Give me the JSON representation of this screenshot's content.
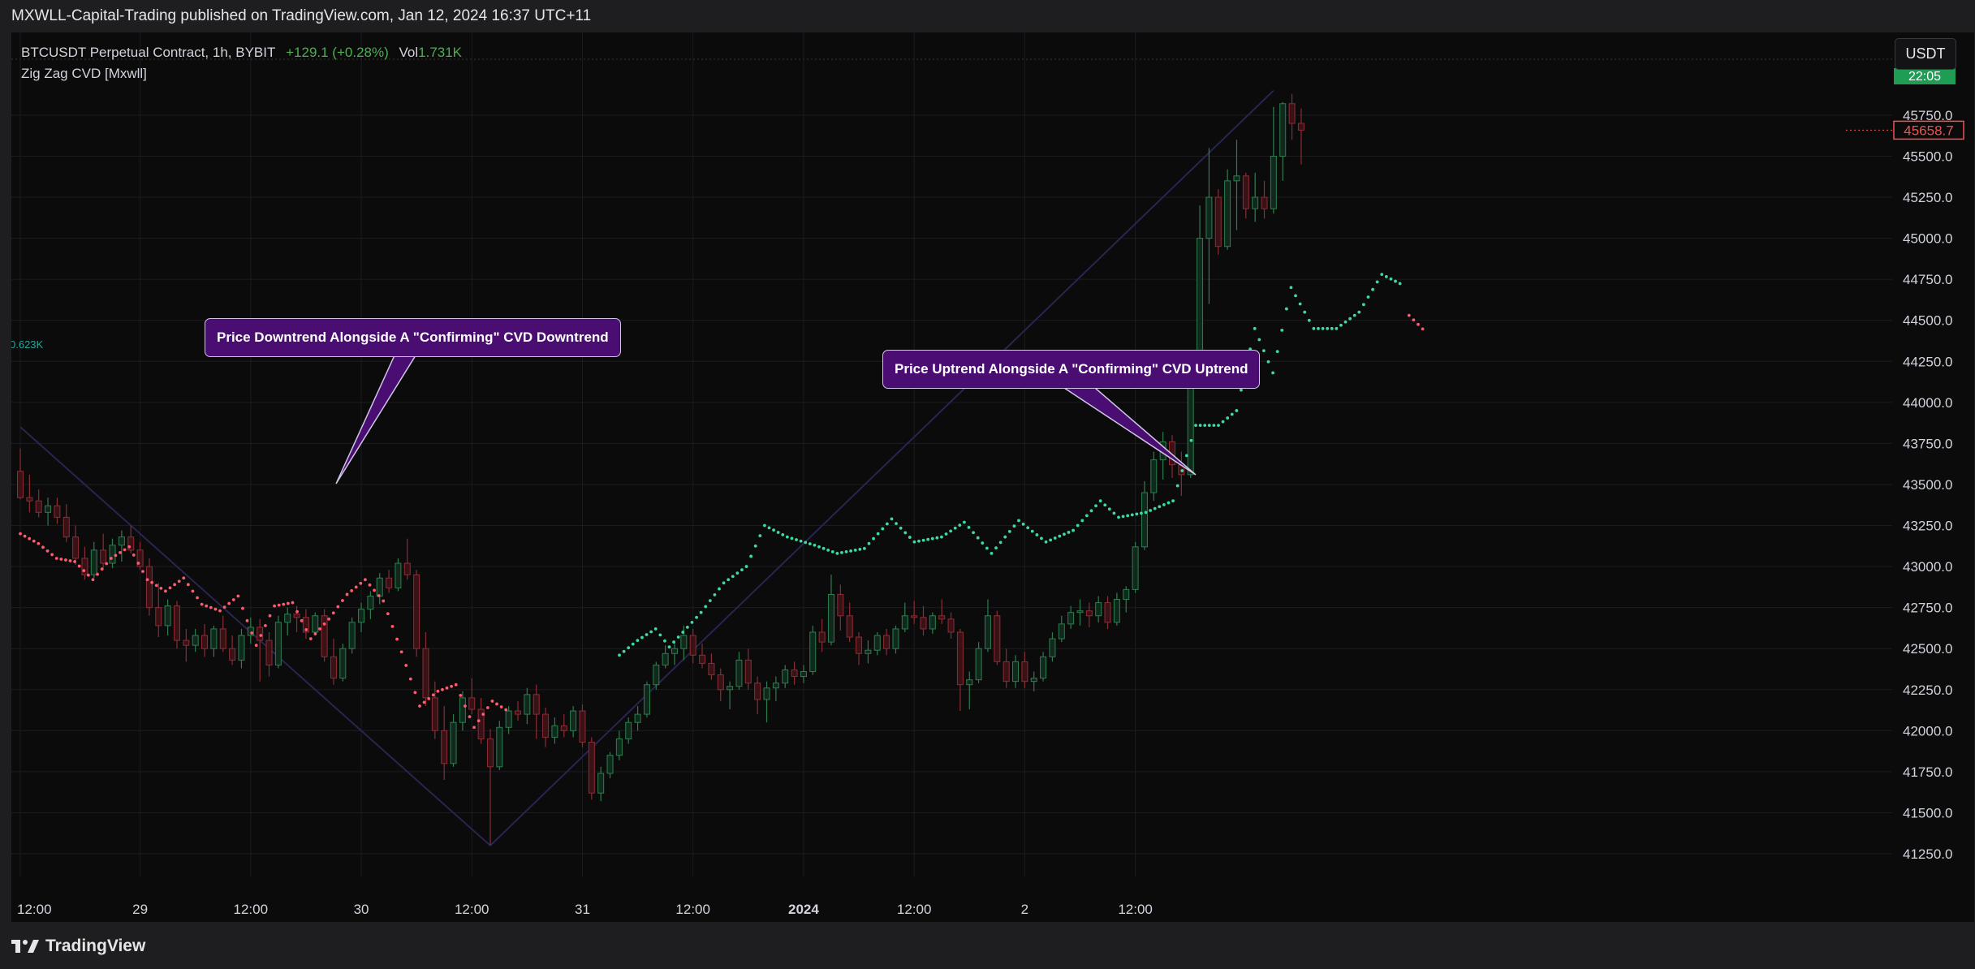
{
  "header": {
    "published": "MXWLL-Capital-Trading published on TradingView.com, Jan 12, 2024 16:37 UTC+11"
  },
  "legend": {
    "symbol": "BTCUSDT Perpetual Contract, 1h, BYBIT",
    "change": "+129.1 (+0.28%)",
    "vol_label": "Vol",
    "vol_value": "1.731K",
    "indicator": "Zig Zag CVD [Mxwll]",
    "left_value": "0.623K"
  },
  "currency_button": "USDT",
  "time_tag": "22:05",
  "price_tag": "45658.7",
  "annotations": [
    {
      "text": "Price Downtrend Alongside A \"Confirming\" CVD Downtrend"
    },
    {
      "text": "Price Uptrend Alongside A \"Confirming\" CVD Uptrend"
    }
  ],
  "footer": {
    "brand": "TradingView"
  },
  "colors": {
    "background": "#0b0b0c",
    "up": "#26a69a",
    "down": "#ef5350",
    "cvd_up": "#3fd9a2",
    "cvd_down": "#ff5a6e",
    "zigzag": "#2a2450",
    "callout": "#4a0e72"
  },
  "chart_data": {
    "type": "candlestick",
    "title": "",
    "xlabel": "",
    "ylabel": "",
    "x_ticks": [
      "12:00",
      "29",
      "12:00",
      "30",
      "12:00",
      "31",
      "12:00",
      "2024",
      "12:00",
      "2",
      "12:00"
    ],
    "x_tick_index": [
      0,
      13,
      25,
      37,
      49,
      61,
      73,
      85,
      97,
      109,
      121
    ],
    "y_ticks": [
      41250.0,
      41500.0,
      41750.0,
      42000.0,
      42250.0,
      42500.0,
      42750.0,
      43000.0,
      43250.0,
      43500.0,
      43750.0,
      44000.0,
      44250.0,
      44500.0,
      44750.0,
      45000.0,
      45250.0,
      45500.0,
      45750.0
    ],
    "ylim": [
      41100,
      45950
    ],
    "last_price": 45658.7,
    "candles": [
      [
        43580,
        43720,
        43410,
        43420
      ],
      [
        43420,
        43560,
        43330,
        43400
      ],
      [
        43400,
        43470,
        43300,
        43330
      ],
      [
        43330,
        43420,
        43250,
        43370
      ],
      [
        43370,
        43420,
        43260,
        43300
      ],
      [
        43300,
        43380,
        43150,
        43180
      ],
      [
        43180,
        43250,
        43010,
        43050
      ],
      [
        43050,
        43120,
        42920,
        42950
      ],
      [
        42950,
        43150,
        42930,
        43100
      ],
      [
        43100,
        43200,
        42980,
        43020
      ],
      [
        43020,
        43170,
        42990,
        43130
      ],
      [
        43130,
        43220,
        43030,
        43180
      ],
      [
        43180,
        43250,
        43080,
        43100
      ],
      [
        43100,
        43150,
        42980,
        43000
      ],
      [
        43000,
        43050,
        42700,
        42750
      ],
      [
        42750,
        42900,
        42570,
        42640
      ],
      [
        42640,
        42800,
        42580,
        42760
      ],
      [
        42760,
        42790,
        42500,
        42550
      ],
      [
        42550,
        42620,
        42420,
        42520
      ],
      [
        42520,
        42620,
        42480,
        42580
      ],
      [
        42580,
        42650,
        42450,
        42500
      ],
      [
        42500,
        42640,
        42450,
        42620
      ],
      [
        42620,
        42700,
        42480,
        42500
      ],
      [
        42500,
        42580,
        42400,
        42430
      ],
      [
        42430,
        42620,
        42380,
        42580
      ],
      [
        42580,
        42690,
        42530,
        42630
      ],
      [
        42630,
        42680,
        42300,
        42550
      ],
      [
        42550,
        42600,
        42330,
        42400
      ],
      [
        42400,
        42700,
        42380,
        42660
      ],
      [
        42660,
        42750,
        42580,
        42710
      ],
      [
        42710,
        42760,
        42600,
        42690
      ],
      [
        42690,
        42740,
        42560,
        42600
      ],
      [
        42600,
        42720,
        42580,
        42700
      ],
      [
        42700,
        42740,
        42420,
        42450
      ],
      [
        42450,
        42560,
        42280,
        42320
      ],
      [
        42320,
        42530,
        42300,
        42500
      ],
      [
        42500,
        42690,
        42470,
        42660
      ],
      [
        42660,
        42780,
        42600,
        42740
      ],
      [
        42740,
        42850,
        42680,
        42820
      ],
      [
        42820,
        42960,
        42770,
        42930
      ],
      [
        42930,
        42980,
        42840,
        42870
      ],
      [
        42870,
        43050,
        42850,
        43020
      ],
      [
        43020,
        43170,
        42920,
        42950
      ],
      [
        42950,
        42980,
        42450,
        42500
      ],
      [
        42500,
        42600,
        42150,
        42200
      ],
      [
        42200,
        42300,
        41950,
        42000
      ],
      [
        42000,
        42150,
        41700,
        41800
      ],
      [
        41800,
        42100,
        41780,
        42050
      ],
      [
        42050,
        42240,
        42000,
        42200
      ],
      [
        42200,
        42320,
        42100,
        42130
      ],
      [
        42130,
        42200,
        41920,
        41950
      ],
      [
        41950,
        42010,
        41300,
        41780
      ],
      [
        41780,
        42060,
        41760,
        42020
      ],
      [
        42020,
        42150,
        41980,
        42120
      ],
      [
        42120,
        42180,
        42060,
        42100
      ],
      [
        42100,
        42260,
        42040,
        42220
      ],
      [
        42220,
        42280,
        41950,
        42100
      ],
      [
        42100,
        42140,
        41900,
        41960
      ],
      [
        41960,
        42080,
        41920,
        42030
      ],
      [
        42030,
        42100,
        41960,
        42000
      ],
      [
        42000,
        42150,
        41960,
        42120
      ],
      [
        42120,
        42160,
        41900,
        41930
      ],
      [
        41930,
        41960,
        41580,
        41620
      ],
      [
        41620,
        41780,
        41570,
        41740
      ],
      [
        41740,
        41870,
        41710,
        41850
      ],
      [
        41850,
        42000,
        41820,
        41950
      ],
      [
        41950,
        42080,
        41920,
        42050
      ],
      [
        42050,
        42150,
        42000,
        42100
      ],
      [
        42100,
        42300,
        42080,
        42280
      ],
      [
        42280,
        42420,
        42250,
        42400
      ],
      [
        42400,
        42520,
        42380,
        42470
      ],
      [
        42470,
        42550,
        42400,
        42500
      ],
      [
        42500,
        42640,
        42430,
        42580
      ],
      [
        42580,
        42620,
        42410,
        42460
      ],
      [
        42460,
        42530,
        42380,
        42410
      ],
      [
        42410,
        42470,
        42310,
        42340
      ],
      [
        42340,
        42380,
        42180,
        42250
      ],
      [
        42250,
        42300,
        42130,
        42270
      ],
      [
        42270,
        42480,
        42250,
        42430
      ],
      [
        42430,
        42500,
        42250,
        42290
      ],
      [
        42290,
        42330,
        42100,
        42190
      ],
      [
        42190,
        42300,
        42050,
        42260
      ],
      [
        42260,
        42330,
        42180,
        42290
      ],
      [
        42290,
        42400,
        42260,
        42370
      ],
      [
        42370,
        42420,
        42280,
        42330
      ],
      [
        42330,
        42400,
        42290,
        42360
      ],
      [
        42360,
        42640,
        42340,
        42600
      ],
      [
        42600,
        42680,
        42480,
        42540
      ],
      [
        42540,
        42950,
        42520,
        42830
      ],
      [
        42830,
        42890,
        42610,
        42700
      ],
      [
        42700,
        42780,
        42540,
        42570
      ],
      [
        42570,
        42600,
        42400,
        42470
      ],
      [
        42470,
        42550,
        42410,
        42490
      ],
      [
        42490,
        42600,
        42460,
        42580
      ],
      [
        42580,
        42620,
        42460,
        42500
      ],
      [
        42500,
        42640,
        42470,
        42620
      ],
      [
        42620,
        42780,
        42600,
        42700
      ],
      [
        42700,
        42790,
        42650,
        42690
      ],
      [
        42690,
        42760,
        42580,
        42620
      ],
      [
        42620,
        42720,
        42590,
        42700
      ],
      [
        42700,
        42800,
        42650,
        42680
      ],
      [
        42680,
        42720,
        42560,
        42600
      ],
      [
        42600,
        42620,
        42120,
        42280
      ],
      [
        42280,
        42360,
        42130,
        42310
      ],
      [
        42310,
        42540,
        42290,
        42500
      ],
      [
        42500,
        42800,
        42480,
        42700
      ],
      [
        42700,
        42730,
        42400,
        42420
      ],
      [
        42420,
        42500,
        42260,
        42300
      ],
      [
        42300,
        42460,
        42260,
        42420
      ],
      [
        42420,
        42480,
        42260,
        42300
      ],
      [
        42300,
        42360,
        42240,
        42320
      ],
      [
        42320,
        42480,
        42300,
        42450
      ],
      [
        42450,
        42600,
        42420,
        42560
      ],
      [
        42560,
        42700,
        42540,
        42650
      ],
      [
        42650,
        42760,
        42620,
        42720
      ],
      [
        42720,
        42800,
        42640,
        42730
      ],
      [
        42730,
        42780,
        42630,
        42700
      ],
      [
        42700,
        42820,
        42660,
        42780
      ],
      [
        42780,
        42820,
        42620,
        42660
      ],
      [
        42660,
        42840,
        42640,
        42800
      ],
      [
        42800,
        42880,
        42720,
        42860
      ],
      [
        42860,
        43150,
        42840,
        43120
      ],
      [
        43120,
        43520,
        43100,
        43450
      ],
      [
        43450,
        43700,
        43400,
        43650
      ],
      [
        43650,
        43820,
        43530,
        43760
      ],
      [
        43760,
        43800,
        43540,
        43620
      ],
      [
        43620,
        43700,
        43430,
        43560
      ],
      [
        43560,
        44280,
        43540,
        44250
      ],
      [
        44250,
        45200,
        44200,
        45000
      ],
      [
        45000,
        45550,
        44600,
        45250
      ],
      [
        45250,
        45300,
        44900,
        44950
      ],
      [
        44950,
        45420,
        44930,
        45350
      ],
      [
        45350,
        45600,
        45050,
        45380
      ],
      [
        45380,
        45400,
        45120,
        45180
      ],
      [
        45180,
        45400,
        45100,
        45250
      ],
      [
        45250,
        45350,
        45120,
        45180
      ],
      [
        45180,
        45800,
        45150,
        45500
      ],
      [
        45500,
        45830,
        45350,
        45820
      ],
      [
        45820,
        45880,
        45600,
        45700
      ],
      [
        45700,
        45790,
        45450,
        45658.7
      ]
    ],
    "cvd_up_points": [
      {
        "x": 132,
        "y": 42460
      },
      {
        "x": 136,
        "y": 42550
      },
      {
        "x": 140,
        "y": 42620
      },
      {
        "x": 143,
        "y": 42510
      },
      {
        "x": 150,
        "y": 42720
      },
      {
        "x": 155,
        "y": 42900
      },
      {
        "x": 160,
        "y": 43000
      },
      {
        "x": 164,
        "y": 43250
      },
      {
        "x": 169,
        "y": 43180
      },
      {
        "x": 175,
        "y": 43130
      },
      {
        "x": 180,
        "y": 43080
      },
      {
        "x": 186,
        "y": 43110
      },
      {
        "x": 192,
        "y": 43290
      },
      {
        "x": 197,
        "y": 43150
      },
      {
        "x": 203,
        "y": 43180
      },
      {
        "x": 208,
        "y": 43270
      },
      {
        "x": 214,
        "y": 43080
      },
      {
        "x": 220,
        "y": 43280
      },
      {
        "x": 226,
        "y": 43150
      },
      {
        "x": 232,
        "y": 43220
      },
      {
        "x": 238,
        "y": 43400
      },
      {
        "x": 242,
        "y": 43300
      },
      {
        "x": 248,
        "y": 43330
      },
      {
        "x": 254,
        "y": 43400
      },
      {
        "x": 259,
        "y": 43860
      },
      {
        "x": 264,
        "y": 43860
      },
      {
        "x": 268,
        "y": 43950
      },
      {
        "x": 272,
        "y": 44450
      },
      {
        "x": 276,
        "y": 44180
      },
      {
        "x": 280,
        "y": 44700
      },
      {
        "x": 285,
        "y": 44450
      },
      {
        "x": 290,
        "y": 44450
      },
      {
        "x": 295,
        "y": 44550
      },
      {
        "x": 300,
        "y": 44780
      },
      {
        "x": 305,
        "y": 44710
      }
    ],
    "cvd_down_points": [
      {
        "x": 0,
        "y": 43200
      },
      {
        "x": 4,
        "y": 43140
      },
      {
        "x": 8,
        "y": 43050
      },
      {
        "x": 12,
        "y": 43030
      },
      {
        "x": 16,
        "y": 42920
      },
      {
        "x": 20,
        "y": 43050
      },
      {
        "x": 24,
        "y": 43120
      },
      {
        "x": 28,
        "y": 42920
      },
      {
        "x": 32,
        "y": 42850
      },
      {
        "x": 36,
        "y": 42930
      },
      {
        "x": 40,
        "y": 42770
      },
      {
        "x": 44,
        "y": 42730
      },
      {
        "x": 48,
        "y": 42820
      },
      {
        "x": 52,
        "y": 42520
      },
      {
        "x": 56,
        "y": 42760
      },
      {
        "x": 60,
        "y": 42780
      },
      {
        "x": 64,
        "y": 42560
      },
      {
        "x": 68,
        "y": 42680
      },
      {
        "x": 72,
        "y": 42830
      },
      {
        "x": 76,
        "y": 42920
      },
      {
        "x": 80,
        "y": 42790
      },
      {
        "x": 84,
        "y": 42480
      },
      {
        "x": 88,
        "y": 42150
      },
      {
        "x": 92,
        "y": 42240
      },
      {
        "x": 96,
        "y": 42280
      },
      {
        "x": 100,
        "y": 42020
      },
      {
        "x": 104,
        "y": 42180
      },
      {
        "x": 108,
        "y": 42110
      },
      {
        "x": 306,
        "y": 44530
      },
      {
        "x": 310,
        "y": 44420
      }
    ],
    "zigzag": [
      {
        "index": 0,
        "price": 43850
      },
      {
        "index": 51,
        "price": 41300
      },
      {
        "index": 136,
        "price": 45900
      }
    ]
  }
}
